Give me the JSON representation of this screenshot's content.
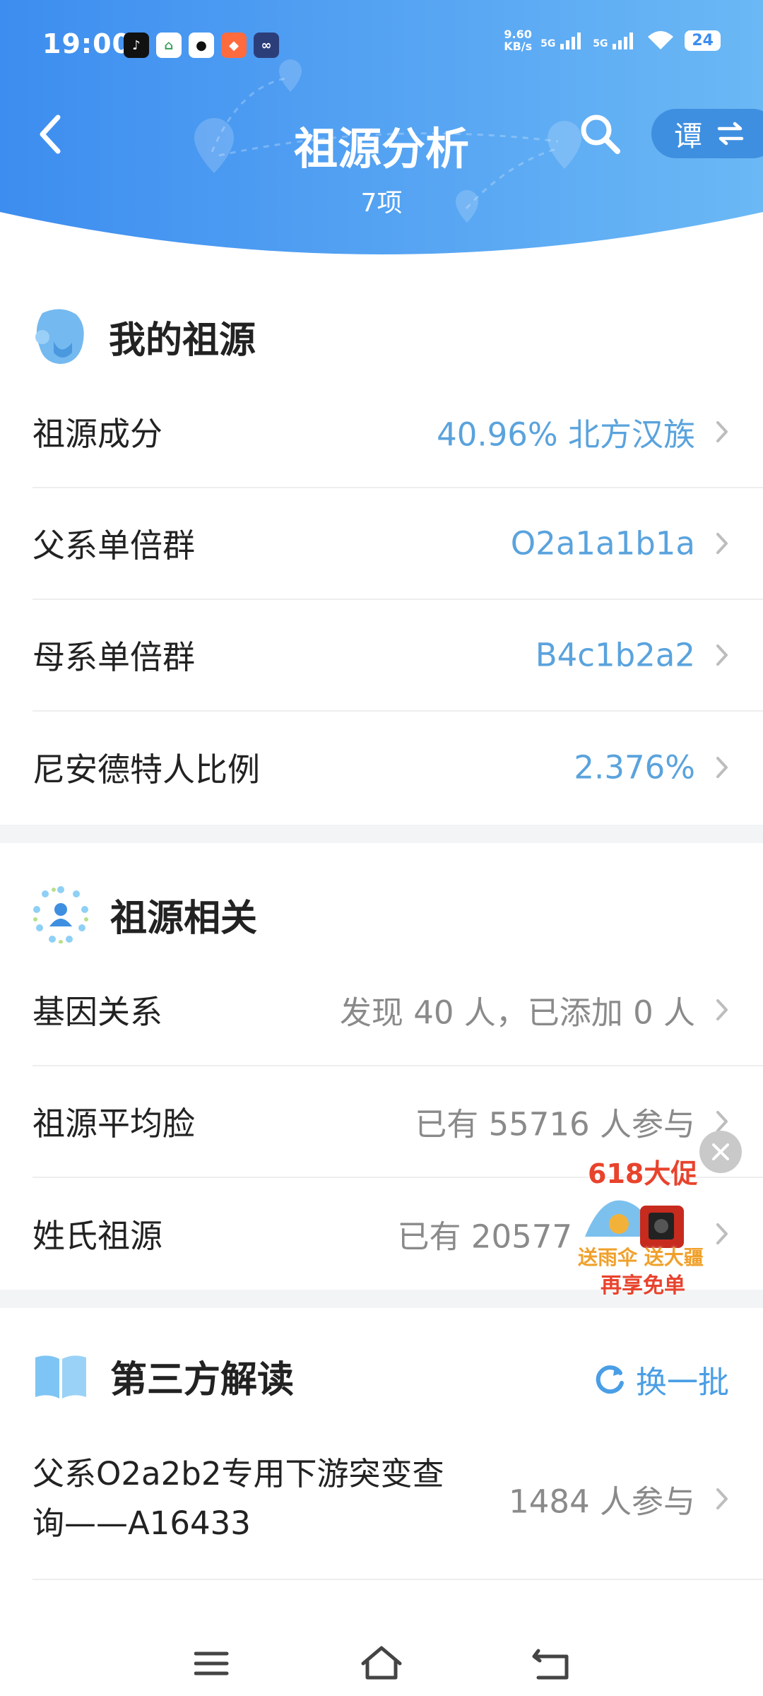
{
  "status_bar": {
    "time": "19:00",
    "net_speed_value": "9.60",
    "net_speed_unit": "KB/s",
    "signal1": "5G",
    "signal2": "5G",
    "battery": "24"
  },
  "header": {
    "title": "祖源分析",
    "subtitle": "7项",
    "surname_label": "谭"
  },
  "my_ancestry": {
    "title": "我的祖源",
    "rows": [
      {
        "label": "祖源成分",
        "value": "40.96% 北方汉族"
      },
      {
        "label": "父系单倍群",
        "value": "O2a1a1b1a"
      },
      {
        "label": "母系单倍群",
        "value": "B4c1b2a2"
      },
      {
        "label": "尼安德特人比例",
        "value": "2.376%"
      }
    ]
  },
  "ancestry_related": {
    "title": "祖源相关",
    "rows": [
      {
        "label": "基因关系",
        "value": "发现 40 人，已添加 0 人"
      },
      {
        "label": "祖源平均脸",
        "value": "已有 55716 人参与"
      },
      {
        "label": "姓氏祖源",
        "value": "已有 20577"
      }
    ]
  },
  "third_party": {
    "title": "第三方解读",
    "refresh_label": "换一批",
    "rows": [
      {
        "label_line1": "父系O2a2b2专用下游突变查",
        "label_line2": "询——A16433",
        "value": "1484 人参与"
      }
    ]
  },
  "ad": {
    "headline": "618大促",
    "line1": "送雨伞 送大疆",
    "line2": "再享免单"
  },
  "icons": [
    "back-icon",
    "search-icon",
    "swap-icon",
    "chevron-right-icon",
    "refresh-icon",
    "close-icon",
    "menu-icon",
    "home-icon",
    "return-icon"
  ],
  "colors": {
    "header_blue": "#4a9ee8",
    "value_blue": "#5aa3dd",
    "accent_blue": "#4a9ee5"
  }
}
